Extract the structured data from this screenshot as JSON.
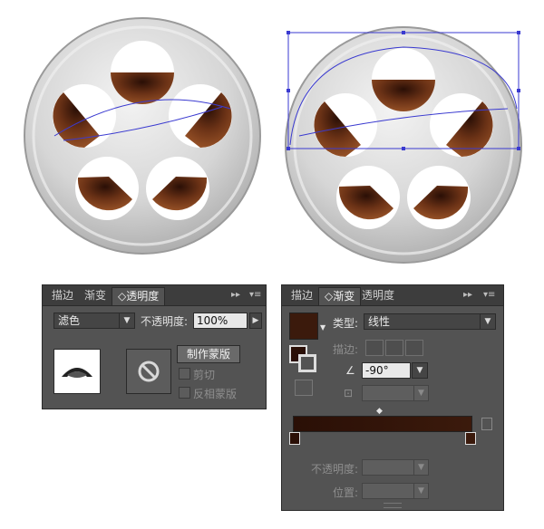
{
  "colors": {
    "panel_bg": "#535353",
    "wood_dark": "#3b1a0c",
    "wood_light": "#8a4a22",
    "metal": "#d9d9d9",
    "selection": "#3a3ad0"
  },
  "transparency_panel": {
    "tabs": [
      "描边",
      "渐变",
      "◇透明度"
    ],
    "blend_mode": "滤色",
    "opacity_label": "不透明度:",
    "opacity_value": "100%",
    "make_mask_button": "制作蒙版",
    "clip_label": "剪切",
    "invert_mask_label": "反相蒙版",
    "no_mask_icon": "circle-slash-icon"
  },
  "gradient_panel": {
    "tabs": [
      "描边",
      "◇渐变",
      "透明度"
    ],
    "type_label": "类型:",
    "type_value": "线性",
    "stroke_label": "描边:",
    "angle_value": "-90°",
    "opacity_label": "不透明度:",
    "location_label": "位置:",
    "gradient_start": "#2a0f06",
    "gradient_end": "#3b1a0c"
  }
}
